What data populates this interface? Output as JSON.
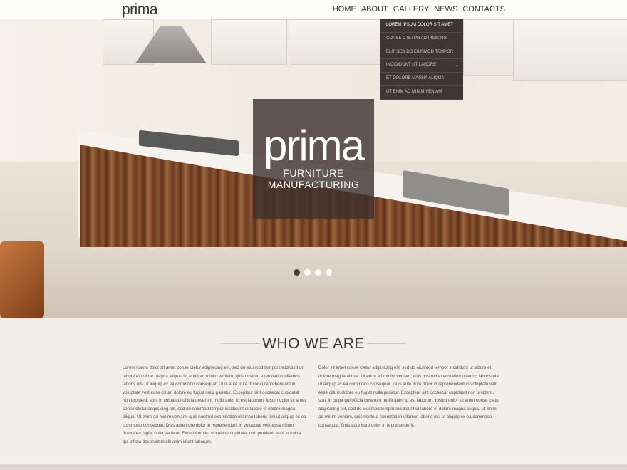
{
  "header": {
    "logo": "prima",
    "nav": [
      "HOME",
      "ABOUT",
      "GALLERY",
      "NEWS",
      "CONTACTS"
    ]
  },
  "dropdown": {
    "items": [
      "LOREM IPSUM DOLOR SIT AMET",
      "CONSE CTETUR ADIPISICING",
      "ELIT SED DO EIUSMOD TEMPOR",
      "INCIDIDUNT UT LABORE",
      "ET DOLORE MAGNA ALIQUA",
      "UT ENIM AD MINIM VENIAM"
    ]
  },
  "hero": {
    "badge_title": "prima",
    "badge_line1": "FURNITURE",
    "badge_line2": "MANUFACTURING",
    "slides": 4,
    "active_slide": 1
  },
  "about": {
    "title": "WHO WE ARE",
    "col1": "Lorem ipsum dolor sit amet conse ctetur adipisicing elit, sed do eiusmod tempor incididunt ut labore et dolore magna aliqua. Ut enim ad minim veniam, quis nostrud exercitation ullamco laboris nisi ut aliquip ex ea commodo consequat. Duis aute irure dolor in reprehenderit in voluptate velit esse cillum dolore eu fugiat nulla pariatur. Excepteur sint occaecat cupidatat non proident, sunt in culpa qui officia deserunt mollit anim id est laborum. Ipsum dolor sit amet conse ctetur adipisicing elit, sed do eiusmod tempor incididunt ut labore et dolore magna aliqua. Ut enim ad minim veniam, quis nostrud exercitation ullamco laboris nisi ut aliquip ex ea commodo consequat. Duis aute irure dolor in reprehenderit in voluptate velit esse cillum dolore eu fugiat nulla pariatur. Excepteur sint occaecat cupidatat non proident, sunt in culpa qui officia deserunt mollit anim id est laborum.",
    "col2": "Dolor sit amet conse ctetur adipisicing elit, sed do eiusmod tempor incididunt ut labore et dolore magna aliqua. Ut enim ad minim veniam, quis nostrud exercitation ullamco laboris nisi ut aliquip ex ea commodo consequat. Duis aute irure dolor in reprehenderit in voluptate velit esse cillum dolore eu fugiat nulla pariatur. Excepteur sint occaecat cupidatat non proident, sunt in culpa qui officia deserunt mollit anim id est laborum. Ipsum dolor sit amet conse ctetur adipisicing elit, sed do eiusmod tempor incididunt ut labore et dolore magna aliqua. Ut enim ad minim veniam, quis nostrud exercitation ullamco laboris nisi ut aliquip ex ea commodo consequat. Duis aute irure dolor in reprehenderit."
  },
  "colors": {
    "accent": "#3f3537",
    "text": "#3d3533",
    "background": "#f1eeeb"
  }
}
